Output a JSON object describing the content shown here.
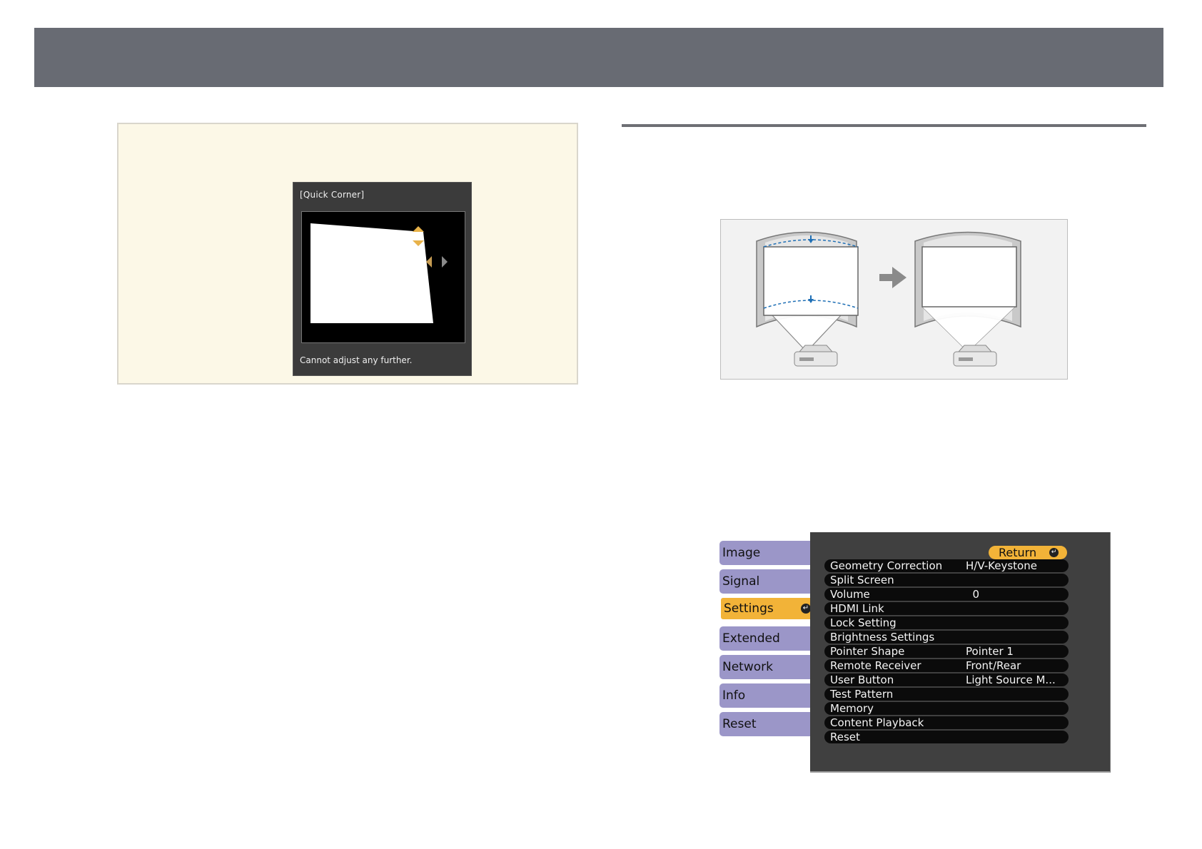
{
  "quick_corner": {
    "title": "[Quick Corner]",
    "message": "Cannot adjust any further."
  },
  "menu": {
    "tabs": [
      {
        "label": "Image"
      },
      {
        "label": "Signal"
      },
      {
        "label": "Settings"
      },
      {
        "label": "Extended"
      },
      {
        "label": "Network"
      },
      {
        "label": "Info"
      },
      {
        "label": "Reset"
      }
    ],
    "active_tab": "Settings",
    "return_label": "Return",
    "items": [
      {
        "label": "Geometry Correction",
        "value": "H/V-Keystone"
      },
      {
        "label": "Split Screen",
        "value": ""
      },
      {
        "label": "Volume",
        "value": "  0"
      },
      {
        "label": "HDMI Link",
        "value": ""
      },
      {
        "label": "Lock Setting",
        "value": ""
      },
      {
        "label": "Brightness Settings",
        "value": ""
      },
      {
        "label": "Pointer Shape",
        "value": "Pointer 1"
      },
      {
        "label": "Remote Receiver",
        "value": "Front/Rear"
      },
      {
        "label": "User Button",
        "value": "Light Source M..."
      },
      {
        "label": "Test Pattern",
        "value": ""
      },
      {
        "label": "Memory",
        "value": ""
      },
      {
        "label": "Content Playback",
        "value": ""
      },
      {
        "label": "Reset",
        "value": ""
      }
    ]
  },
  "colors": {
    "header": "#686b73",
    "note_bg": "#fcf8e7",
    "accent": "#f2b338",
    "tab": "#9b96c8",
    "keystone_line": "#1f6fb5"
  }
}
